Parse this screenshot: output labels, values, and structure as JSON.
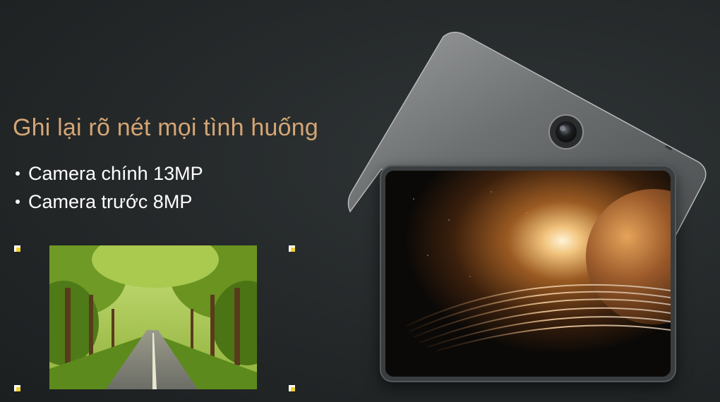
{
  "headline": "Ghi lại rõ nét mọi tình huống",
  "features": [
    "Camera chính 13MP",
    "Camera trước 8MP"
  ],
  "colors": {
    "headline": "#d4a574",
    "background": "#242829",
    "crop_handle": "#f2d22e"
  }
}
